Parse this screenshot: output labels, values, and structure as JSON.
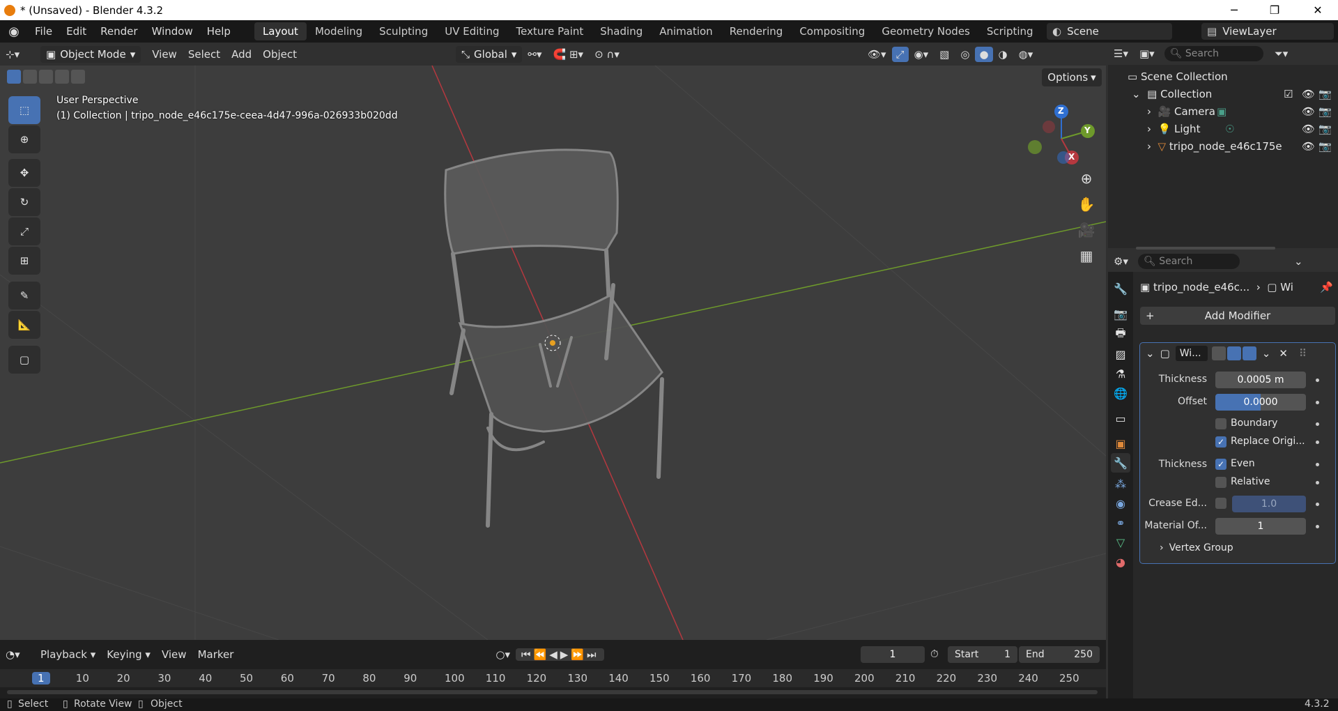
{
  "window": {
    "title": "* (Unsaved) - Blender 4.3.2",
    "minimize": "─",
    "maximize": "❐",
    "close": "✕"
  },
  "menu": {
    "file": "File",
    "edit": "Edit",
    "render": "Render",
    "window": "Window",
    "help": "Help"
  },
  "workspaces": [
    "Layout",
    "Modeling",
    "Sculpting",
    "UV Editing",
    "Texture Paint",
    "Shading",
    "Animation",
    "Rendering",
    "Compositing",
    "Geometry Nodes",
    "Scripting"
  ],
  "scene": {
    "name": "Scene",
    "viewlayer": "ViewLayer"
  },
  "viewport_header": {
    "mode": "Object Mode",
    "view": "View",
    "select": "Select",
    "add": "Add",
    "object": "Object",
    "orientation": "Global",
    "options": "Options"
  },
  "viewport": {
    "perspective": "User Perspective",
    "collection_info": "(1) Collection | tripo_node_e46c175e-ceea-4d47-996a-026933b020dd",
    "gizmo_z": "Z",
    "gizmo_y": "Y",
    "gizmo_x": "X"
  },
  "outliner": {
    "search_placeholder": "Search",
    "root": "Scene Collection",
    "collection": "Collection",
    "items": [
      "Camera",
      "Light",
      "tripo_node_e46c175e"
    ]
  },
  "properties": {
    "search_placeholder": "Search",
    "breadcrumb_object": "tripo_node_e46c...",
    "breadcrumb_mod": "Wi",
    "add_modifier": "Add Modifier",
    "modifier_name": "Wi...",
    "thickness_label": "Thickness",
    "thickness_value": "0.0005 m",
    "offset_label": "Offset",
    "offset_value": "0.0000",
    "boundary": "Boundary",
    "replace_original": "Replace Origi...",
    "thickness2_label": "Thickness",
    "even": "Even",
    "relative": "Relative",
    "crease_label": "Crease Ed...",
    "crease_value": "1.0",
    "material_label": "Material Of...",
    "material_value": "1",
    "vertex_group": "Vertex Group"
  },
  "timeline": {
    "playback": "Playback",
    "keying": "Keying",
    "view": "View",
    "marker": "Marker",
    "current_frame": "1",
    "start_label": "Start",
    "start": "1",
    "end_label": "End",
    "end": "250",
    "ruler": [
      "1",
      "10",
      "20",
      "30",
      "40",
      "50",
      "60",
      "70",
      "80",
      "90",
      "100",
      "110",
      "120",
      "130",
      "140",
      "150",
      "160",
      "170",
      "180",
      "190",
      "200",
      "210",
      "220",
      "230",
      "240",
      "250"
    ]
  },
  "status": {
    "select": "Select",
    "rotate": "Rotate View",
    "object": "Object",
    "version": "4.3.2"
  },
  "colors": {
    "accent": "#4772b3",
    "x_axis": "#b5383f",
    "y_axis": "#6e9a2b",
    "z_axis": "#2f6fd1"
  }
}
